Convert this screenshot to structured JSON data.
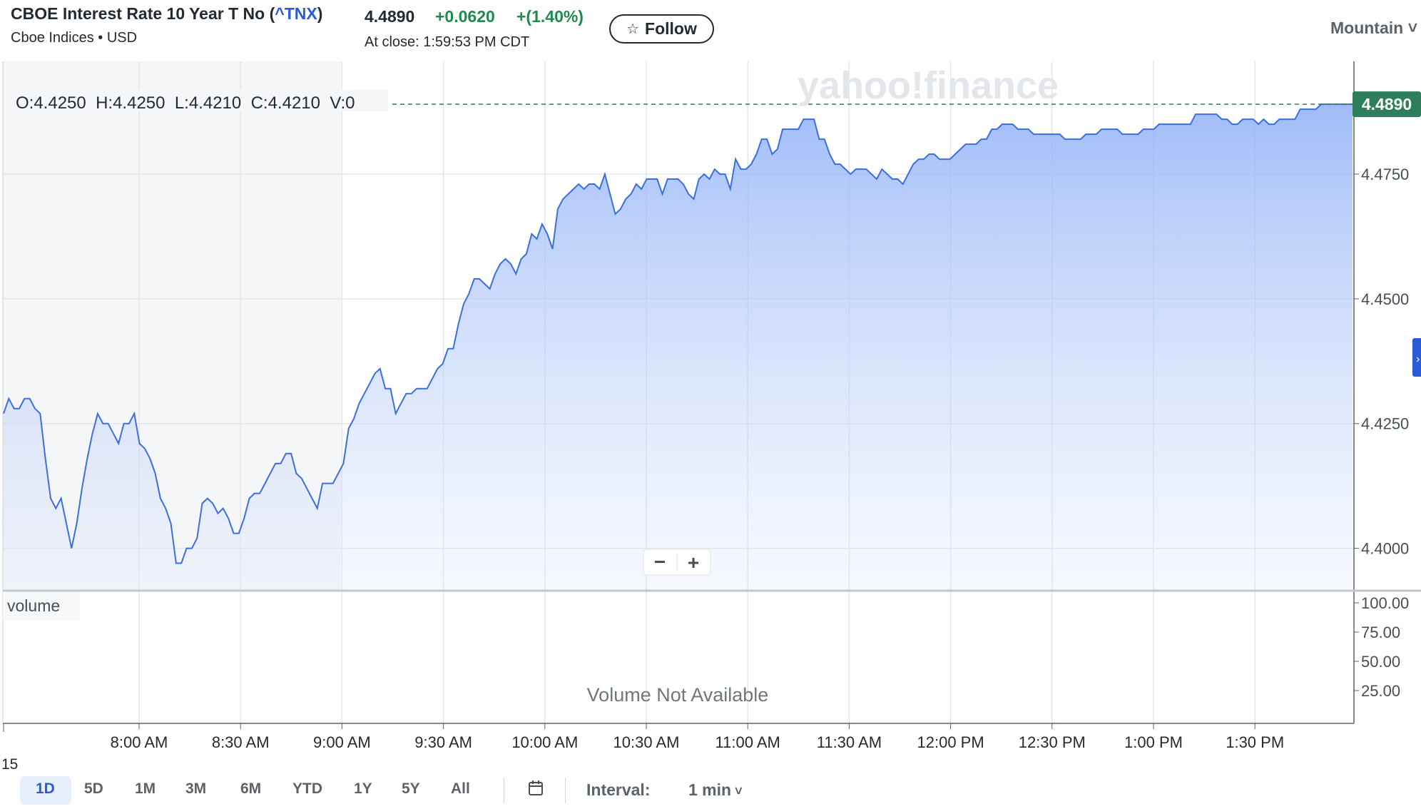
{
  "header": {
    "title_prefix": "CBOE Interest Rate 10 Year T No (",
    "ticker": "^TNX",
    "title_suffix": ")",
    "exchange": "Cboe Indices • USD",
    "price": "4.4890",
    "change": "+0.0620",
    "change_pct": "+(1.40%)",
    "close_time": "At close: 1:59:53 PM CDT",
    "follow_label": "Follow",
    "timezone": "Mountain"
  },
  "ohlcv": "O:4.4250  H:4.4250  L:4.4210  C:4.4210  V:0",
  "watermark": "yahoo!finance",
  "volume_label": "volume",
  "volume_note": "Volume Not Available",
  "zoom": {
    "minus": "−",
    "plus": "+"
  },
  "current_price_tag": "4.4890",
  "date_marker": "15",
  "chart_data": {
    "type": "area",
    "title": "",
    "y_ticks": [
      "4.4750",
      "4.4500",
      "4.4250",
      "4.4000"
    ],
    "y_tick_values": [
      4.475,
      4.45,
      4.425,
      4.4
    ],
    "ylim": [
      4.3915,
      4.4976
    ],
    "volume_ticks": [
      "100.00",
      "75.00",
      "50.00",
      "25.00"
    ],
    "x_tick_labels": [
      "8:00 AM",
      "8:30 AM",
      "9:00 AM",
      "9:30 AM",
      "10:00 AM",
      "10:30 AM",
      "11:00 AM",
      "11:30 AM",
      "12:00 PM",
      "12:30 PM",
      "1:00 PM",
      "1:30 PM"
    ],
    "x_range": [
      "7:20 AM",
      "2:00 PM"
    ],
    "reference_line": 4.489,
    "series": [
      {
        "values": [
          4.427,
          4.43,
          4.428,
          4.428,
          4.43,
          4.43,
          4.428,
          4.427,
          4.418,
          4.41,
          4.408,
          4.41,
          4.405,
          4.4,
          4.405,
          4.412,
          4.418,
          4.423,
          4.427,
          4.425,
          4.425,
          4.423,
          4.421,
          4.425,
          4.425,
          4.427,
          4.421,
          4.42,
          4.418,
          4.415,
          4.41,
          4.408,
          4.405,
          4.397,
          4.397,
          4.4,
          4.4,
          4.402,
          4.409,
          4.41,
          4.409,
          4.407,
          4.408,
          4.406,
          4.403,
          4.403,
          4.406,
          4.41,
          4.411,
          4.411,
          4.413,
          4.415,
          4.417,
          4.417,
          4.419,
          4.419,
          4.415,
          4.414,
          4.412,
          4.41,
          4.408,
          4.413,
          4.413,
          4.413,
          4.415,
          4.417,
          4.424,
          4.426,
          4.429,
          4.431,
          4.433,
          4.435,
          4.436,
          4.432,
          4.432,
          4.427,
          4.429,
          4.431,
          4.431,
          4.432,
          4.432,
          4.432,
          4.434,
          4.436,
          4.437,
          4.44,
          4.44,
          4.445,
          4.449,
          4.451,
          4.454,
          4.454,
          4.453,
          4.452,
          4.455,
          4.457,
          4.458,
          4.457,
          4.455,
          4.458,
          4.459,
          4.463,
          4.462,
          4.465,
          4.463,
          4.46,
          4.468,
          4.47,
          4.471,
          4.472,
          4.473,
          4.472,
          4.473,
          4.473,
          4.472,
          4.475,
          4.471,
          4.467,
          4.468,
          4.47,
          4.471,
          4.473,
          4.472,
          4.474,
          4.474,
          4.474,
          4.471,
          4.474,
          4.474,
          4.474,
          4.473,
          4.471,
          4.47,
          4.474,
          4.475,
          4.474,
          4.476,
          4.475,
          4.475,
          4.472,
          4.478,
          4.476,
          4.476,
          4.477,
          4.479,
          4.482,
          4.482,
          4.479,
          4.48,
          4.484,
          4.484,
          4.484,
          4.484,
          4.486,
          4.486,
          4.486,
          4.482,
          4.482,
          4.479,
          4.477,
          4.477,
          4.476,
          4.475,
          4.476,
          4.476,
          4.476,
          4.475,
          4.474,
          4.476,
          4.475,
          4.474,
          4.474,
          4.473,
          4.475,
          4.477,
          4.478,
          4.478,
          4.479,
          4.479,
          4.478,
          4.478,
          4.478,
          4.479,
          4.48,
          4.481,
          4.481,
          4.481,
          4.482,
          4.482,
          4.484,
          4.484,
          4.485,
          4.485,
          4.485,
          4.484,
          4.484,
          4.484,
          4.483,
          4.483,
          4.483,
          4.483,
          4.483,
          4.483,
          4.482,
          4.482,
          4.482,
          4.482,
          4.483,
          4.483,
          4.483,
          4.484,
          4.484,
          4.484,
          4.484,
          4.483,
          4.483,
          4.483,
          4.483,
          4.484,
          4.484,
          4.484,
          4.485,
          4.485,
          4.485,
          4.485,
          4.485,
          4.485,
          4.485,
          4.487,
          4.487,
          4.487,
          4.487,
          4.487,
          4.486,
          4.486,
          4.485,
          4.485,
          4.486,
          4.486,
          4.486,
          4.485,
          4.486,
          4.485,
          4.485,
          4.486,
          4.486,
          4.486,
          4.486,
          4.488,
          4.488,
          4.488,
          4.488,
          4.489,
          4.489,
          4.489,
          4.489,
          4.489,
          4.489,
          4.489
        ]
      }
    ]
  },
  "range_buttons": [
    "1D",
    "5D",
    "1M",
    "3M",
    "6M",
    "YTD",
    "1Y",
    "5Y",
    "All"
  ],
  "active_range": "1D",
  "interval": {
    "label": "Interval:",
    "value": "1 min"
  },
  "colors": {
    "line": "#3b6fe0",
    "positive": "#1f8a4c",
    "accent": "#2a5bd7",
    "price_tag": "#2f7e5b"
  }
}
